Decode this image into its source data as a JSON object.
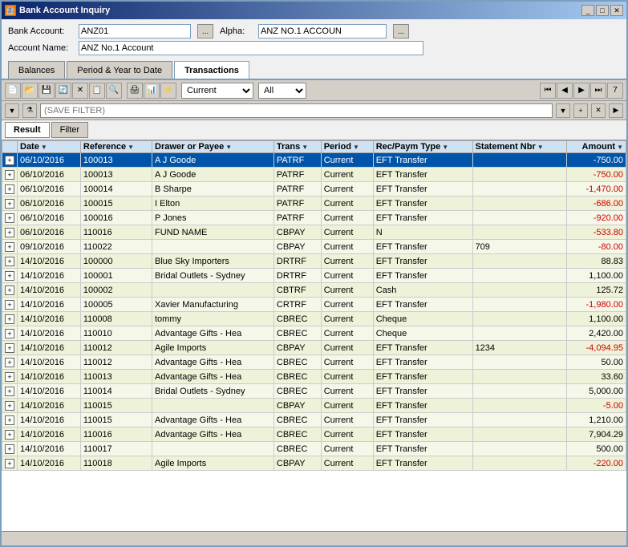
{
  "window": {
    "title": "Bank Account Inquiry"
  },
  "form": {
    "bank_account_label": "Bank Account:",
    "bank_account_value": "ANZ01",
    "alpha_label": "Alpha:",
    "alpha_value": "ANZ NO.1 ACCOUN",
    "account_name_label": "Account Name:",
    "account_name_value": "ANZ No.1 Account"
  },
  "tabs": [
    {
      "label": "Balances",
      "active": false
    },
    {
      "label": "Period & Year to Date",
      "active": false
    },
    {
      "label": "Transactions",
      "active": true
    }
  ],
  "toolbar": {
    "current_label": "Current",
    "all_label": "All"
  },
  "filter": {
    "placeholder": "(SAVE FILTER)"
  },
  "result_tabs": [
    {
      "label": "Result",
      "active": true
    },
    {
      "label": "Filter",
      "active": false
    }
  ],
  "columns": [
    {
      "label": "Date",
      "sortable": true
    },
    {
      "label": "Reference",
      "sortable": true
    },
    {
      "label": "Drawer or Payee",
      "sortable": true
    },
    {
      "label": "Trans",
      "sortable": true
    },
    {
      "label": "Period",
      "sortable": true
    },
    {
      "label": "Rec/Paym Type",
      "sortable": true
    },
    {
      "label": "Statement Nbr",
      "sortable": true
    },
    {
      "label": "Amount",
      "sortable": true
    }
  ],
  "rows": [
    {
      "date": "06/10/2016",
      "reference": "100013",
      "payee": "A J Goode",
      "trans": "PATRF",
      "period": "Current",
      "rec_type": "EFT Transfer",
      "stmt_nbr": "",
      "amount": "-750.00",
      "negative": true,
      "selected": true
    },
    {
      "date": "06/10/2016",
      "reference": "100013",
      "payee": "A J Goode",
      "trans": "PATRF",
      "period": "Current",
      "rec_type": "EFT Transfer",
      "stmt_nbr": "",
      "amount": "-750.00",
      "negative": true,
      "selected": false
    },
    {
      "date": "06/10/2016",
      "reference": "100014",
      "payee": "B Sharpe",
      "trans": "PATRF",
      "period": "Current",
      "rec_type": "EFT Transfer",
      "stmt_nbr": "",
      "amount": "-1,470.00",
      "negative": true,
      "selected": false
    },
    {
      "date": "06/10/2016",
      "reference": "100015",
      "payee": "I Elton",
      "trans": "PATRF",
      "period": "Current",
      "rec_type": "EFT Transfer",
      "stmt_nbr": "",
      "amount": "-686.00",
      "negative": true,
      "selected": false
    },
    {
      "date": "06/10/2016",
      "reference": "100016",
      "payee": "P Jones",
      "trans": "PATRF",
      "period": "Current",
      "rec_type": "EFT Transfer",
      "stmt_nbr": "",
      "amount": "-920.00",
      "negative": true,
      "selected": false
    },
    {
      "date": "06/10/2016",
      "reference": "110016",
      "payee": "FUND NAME",
      "trans": "CBPAY",
      "period": "Current",
      "rec_type": "N",
      "stmt_nbr": "",
      "amount": "-533.80",
      "negative": true,
      "selected": false
    },
    {
      "date": "09/10/2016",
      "reference": "110022",
      "payee": "",
      "trans": "CBPAY",
      "period": "Current",
      "rec_type": "EFT Transfer",
      "stmt_nbr": "709",
      "amount": "-80.00",
      "negative": true,
      "selected": false
    },
    {
      "date": "14/10/2016",
      "reference": "100000",
      "payee": "Blue Sky Importers",
      "trans": "DRTRF",
      "period": "Current",
      "rec_type": "EFT Transfer",
      "stmt_nbr": "",
      "amount": "88.83",
      "negative": false,
      "selected": false
    },
    {
      "date": "14/10/2016",
      "reference": "100001",
      "payee": "Bridal Outlets - Sydney",
      "trans": "DRTRF",
      "period": "Current",
      "rec_type": "EFT Transfer",
      "stmt_nbr": "",
      "amount": "1,100.00",
      "negative": false,
      "selected": false
    },
    {
      "date": "14/10/2016",
      "reference": "100002",
      "payee": "",
      "trans": "CBTRF",
      "period": "Current",
      "rec_type": "Cash",
      "stmt_nbr": "",
      "amount": "125.72",
      "negative": false,
      "selected": false
    },
    {
      "date": "14/10/2016",
      "reference": "100005",
      "payee": "Xavier Manufacturing",
      "trans": "CRTRF",
      "period": "Current",
      "rec_type": "EFT Transfer",
      "stmt_nbr": "",
      "amount": "-1,980.00",
      "negative": true,
      "selected": false
    },
    {
      "date": "14/10/2016",
      "reference": "110008",
      "payee": "tommy",
      "trans": "CBREC",
      "period": "Current",
      "rec_type": "Cheque",
      "stmt_nbr": "",
      "amount": "1,100.00",
      "negative": false,
      "selected": false
    },
    {
      "date": "14/10/2016",
      "reference": "110010",
      "payee": "Advantage Gifts - Hea",
      "trans": "CBREC",
      "period": "Current",
      "rec_type": "Cheque",
      "stmt_nbr": "",
      "amount": "2,420.00",
      "negative": false,
      "selected": false
    },
    {
      "date": "14/10/2016",
      "reference": "110012",
      "payee": "Agile Imports",
      "trans": "CBPAY",
      "period": "Current",
      "rec_type": "EFT Transfer",
      "stmt_nbr": "1234",
      "amount": "-4,094.95",
      "negative": true,
      "selected": false
    },
    {
      "date": "14/10/2016",
      "reference": "110012",
      "payee": "Advantage Gifts - Hea",
      "trans": "CBREC",
      "period": "Current",
      "rec_type": "EFT Transfer",
      "stmt_nbr": "",
      "amount": "50.00",
      "negative": false,
      "selected": false
    },
    {
      "date": "14/10/2016",
      "reference": "110013",
      "payee": "Advantage Gifts - Hea",
      "trans": "CBREC",
      "period": "Current",
      "rec_type": "EFT Transfer",
      "stmt_nbr": "",
      "amount": "33.60",
      "negative": false,
      "selected": false
    },
    {
      "date": "14/10/2016",
      "reference": "110014",
      "payee": "Bridal Outlets - Sydney",
      "trans": "CBREC",
      "period": "Current",
      "rec_type": "EFT Transfer",
      "stmt_nbr": "",
      "amount": "5,000.00",
      "negative": false,
      "selected": false
    },
    {
      "date": "14/10/2016",
      "reference": "110015",
      "payee": "",
      "trans": "CBPAY",
      "period": "Current",
      "rec_type": "EFT Transfer",
      "stmt_nbr": "",
      "amount": "-5.00",
      "negative": true,
      "selected": false
    },
    {
      "date": "14/10/2016",
      "reference": "110015",
      "payee": "Advantage Gifts - Hea",
      "trans": "CBREC",
      "period": "Current",
      "rec_type": "EFT Transfer",
      "stmt_nbr": "",
      "amount": "1,210.00",
      "negative": false,
      "selected": false
    },
    {
      "date": "14/10/2016",
      "reference": "110016",
      "payee": "Advantage Gifts - Hea",
      "trans": "CBREC",
      "period": "Current",
      "rec_type": "EFT Transfer",
      "stmt_nbr": "",
      "amount": "7,904.29",
      "negative": false,
      "selected": false
    },
    {
      "date": "14/10/2016",
      "reference": "110017",
      "payee": "",
      "trans": "CBREC",
      "period": "Current",
      "rec_type": "EFT Transfer",
      "stmt_nbr": "",
      "amount": "500.00",
      "negative": false,
      "selected": false
    },
    {
      "date": "14/10/2016",
      "reference": "110018",
      "payee": "Agile Imports",
      "trans": "CBPAY",
      "period": "Current",
      "rec_type": "EFT Transfer",
      "stmt_nbr": "",
      "amount": "-220.00",
      "negative": true,
      "selected": false
    }
  ]
}
